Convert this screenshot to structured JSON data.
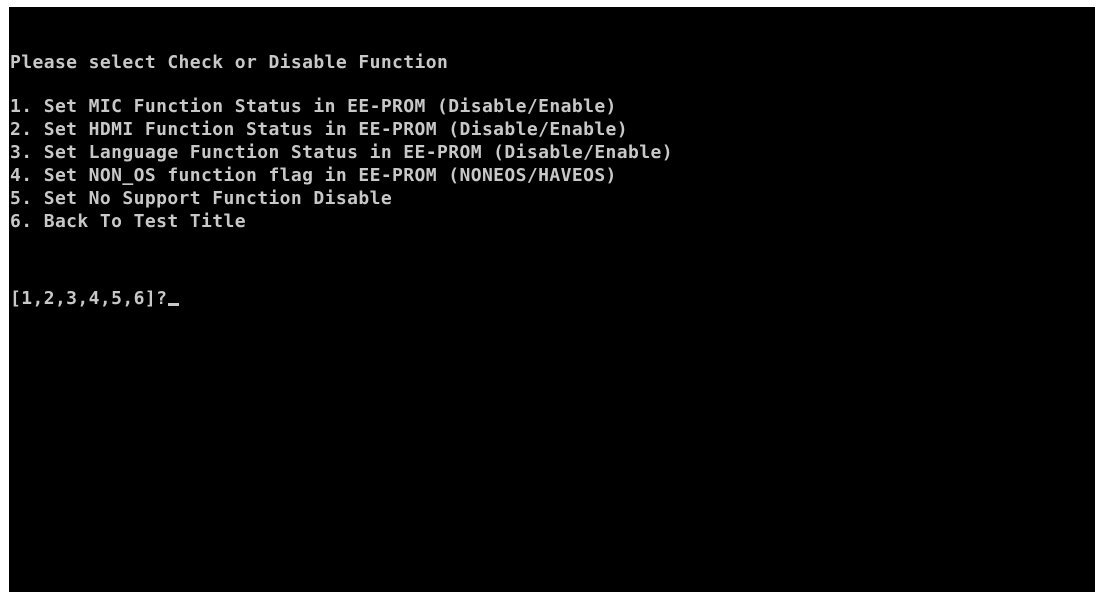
{
  "colors": {
    "background": "#000000",
    "text": "#c8c8c8"
  },
  "console": {
    "heading": "Please select Check or Disable Function",
    "menu": [
      "1. Set MIC Function Status in EE-PROM (Disable/Enable)",
      "2. Set HDMI Function Status in EE-PROM (Disable/Enable)",
      "3. Set Language Function Status in EE-PROM (Disable/Enable)",
      "4. Set NON_OS function flag in EE-PROM (NONEOS/HAVEOS)",
      "5. Set No Support Function Disable",
      "6. Back To Test Title"
    ],
    "prompt": "[1,2,3,4,5,6]?"
  }
}
